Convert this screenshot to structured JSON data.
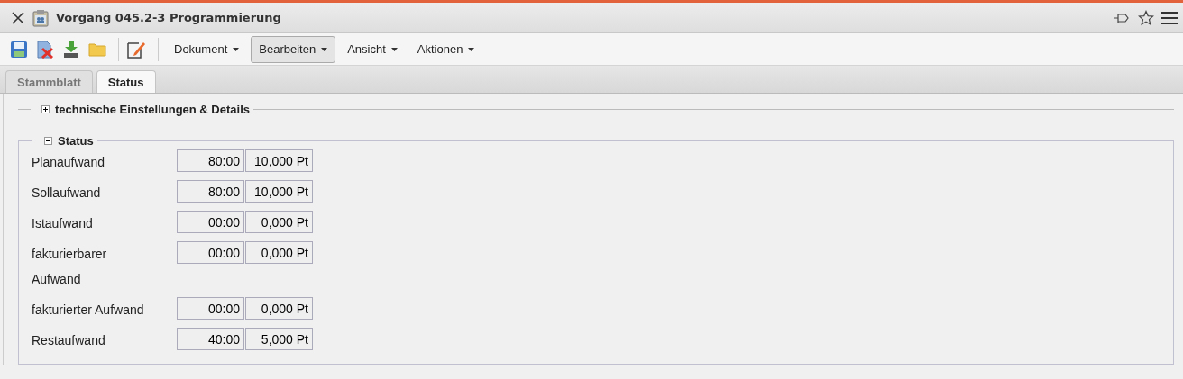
{
  "window": {
    "title": "Vorgang 045.2-3 Programmierung"
  },
  "toolbar": {
    "menus": [
      {
        "label": "Dokument",
        "selected": false
      },
      {
        "label": "Bearbeiten",
        "selected": true
      },
      {
        "label": "Ansicht",
        "selected": false
      },
      {
        "label": "Aktionen",
        "selected": false
      }
    ]
  },
  "tabs": [
    {
      "label": "Stammblatt",
      "selected": false
    },
    {
      "label": "Status",
      "selected": true
    }
  ],
  "sections": [
    {
      "title": "technische Einstellungen & Details",
      "expanded": false
    },
    {
      "title": "Status",
      "expanded": true,
      "rows": [
        {
          "label": "Planaufwand",
          "time": "80:00",
          "points": "10,000 Pt"
        },
        {
          "label": "Sollaufwand",
          "time": "80:00",
          "points": "10,000 Pt"
        },
        {
          "label": "Istaufwand",
          "time": "00:00",
          "points": "0,000 Pt"
        },
        {
          "label": "fakturierbarer Aufwand",
          "time": "00:00",
          "points": "0,000 Pt"
        },
        {
          "label": "fakturierter Aufwand",
          "time": "00:00",
          "points": "0,000 Pt"
        },
        {
          "label": "Restaufwand",
          "time": "40:00",
          "points": "5,000 Pt"
        }
      ]
    }
  ]
}
